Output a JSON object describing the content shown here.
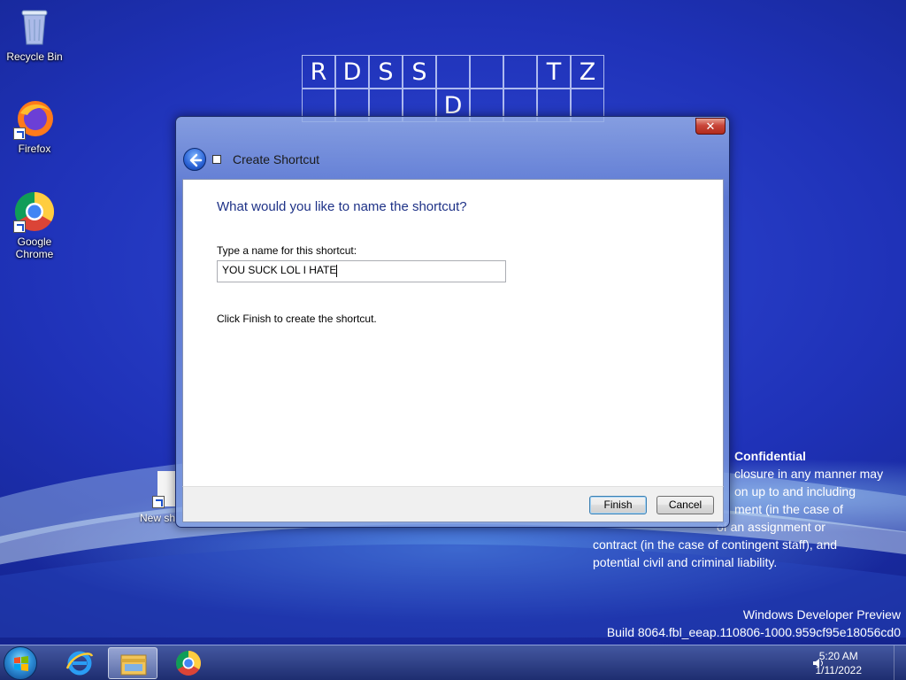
{
  "desktop": {
    "icons": [
      {
        "label": "Recycle Bin",
        "icon": "recycle-bin-icon"
      },
      {
        "label": "Firefox",
        "icon": "firefox-icon"
      },
      {
        "label": "Google Chrome",
        "icon": "chrome-icon"
      }
    ],
    "new_shortcut_partial_label": "New sh",
    "board_letters": [
      "R",
      "D",
      "S",
      "S",
      "",
      "",
      "",
      "T",
      "Z"
    ],
    "board_second_row": "D",
    "watermark": {
      "title": "Confidential",
      "lines": [
        "closure in any manner may",
        "on up to and including",
        "ment (in the case of",
        "of an assignment or",
        "contract (in the case of contingent staff), and",
        "potential civil and criminal liability."
      ]
    },
    "build": {
      "line1": "Windows Developer Preview",
      "line2": "Build 8064.fbl_eeap.110806-1000.959cf95e18056cd0"
    }
  },
  "dialog": {
    "title": "Create Shortcut",
    "close_label": "✕",
    "heading": "What would you like to name the shortcut?",
    "field_label": "Type a name for this shortcut:",
    "field_value": "YOU SUCK LOL I HATE",
    "hint": "Click Finish to create the shortcut.",
    "finish_label": "Finish",
    "cancel_label": "Cancel"
  },
  "taskbar": {
    "pinned": [
      "internet-explorer-icon",
      "file-explorer-icon",
      "chrome-icon"
    ],
    "time": "5:20 AM",
    "date": "1/11/2022"
  },
  "colors": {
    "accent": "#1e3287",
    "wallpaper": "#1f32b8",
    "close_red": "#c9463a"
  }
}
